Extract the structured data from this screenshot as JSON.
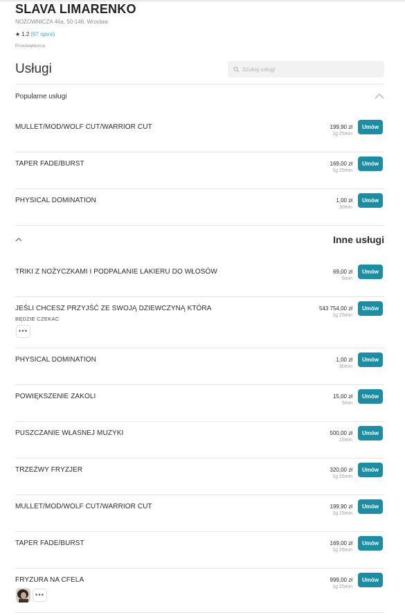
{
  "business": {
    "name": "SLAVA LIMARENKO",
    "address": "NOŻOWNICZA 46a, 50-146, Wrocław",
    "rating": "1.2",
    "reviews": "(67 opinii)",
    "tag": "Przedsiębiorca"
  },
  "services": {
    "title": "Usługi",
    "search_placeholder": "Szukaj usługi"
  },
  "groups": [
    {
      "title": "Popularne usługi",
      "items": [
        {
          "name": "MULLET/MOD/WOLF CUT/WARRIOR CUT",
          "price": "199,90 zł",
          "duration": "1g 25min",
          "book": "Umów"
        },
        {
          "name": "TAPER FADE/BURST",
          "price": "169,00 zł",
          "duration": "1g 25min",
          "book": "Umów"
        },
        {
          "name": "PHYSICAL DOMINATION",
          "price": "1,00 zł",
          "duration": "30min",
          "book": "Umów"
        }
      ]
    },
    {
      "title": "Inne usługi",
      "items": [
        {
          "name": "TRIKI Z NOŻYCZKAMI I PODPALANIE LAKIERU DO WŁOSÓW",
          "price": "69,00 zł",
          "duration": "5min",
          "book": "Umów"
        },
        {
          "name": "JEŚLI CHCESZ PRZYJŚĆ ZE SWOJĄ DZIEWCZYNĄ KTÓRA",
          "name_cont": "BĘDZIE CZEKAĆ",
          "price": "543 754,00 zł",
          "duration": "1g 25min",
          "book": "Umów"
        },
        {
          "name": "PHYSICAL DOMINATION",
          "price": "1,00 zł",
          "duration": "30min",
          "book": "Umów"
        },
        {
          "name": "POWIĘKSZENIE ZAKOLI",
          "price": "15,00 zł",
          "duration": "5min",
          "book": "Umów"
        },
        {
          "name": "PUSZCZANIE WŁASNEJ MUZYKI",
          "price": "500,00 zł",
          "duration": "15min",
          "book": "Umów"
        },
        {
          "name": "TRZEŹWY FRYZJER",
          "price": "320,00 zł",
          "duration": "1g 25min",
          "book": "Umów"
        },
        {
          "name": "MULLET/MOD/WOLF CUT/WARRIOR CUT",
          "price": "199,90 zł",
          "duration": "1g 25min",
          "book": "Umów"
        },
        {
          "name": "TAPER FADE/BURST",
          "price": "169,00 zł",
          "duration": "1g 25min",
          "book": "Umów"
        },
        {
          "name": "FRYZURA NA CFELA",
          "price": "999,00 zł",
          "duration": "1g 25min",
          "book": "Umów"
        }
      ]
    }
  ],
  "more_label": "•••",
  "colors": {
    "accent": "#1b8ea5",
    "link": "#3ab3c0",
    "divider": "#e6e6e6"
  }
}
